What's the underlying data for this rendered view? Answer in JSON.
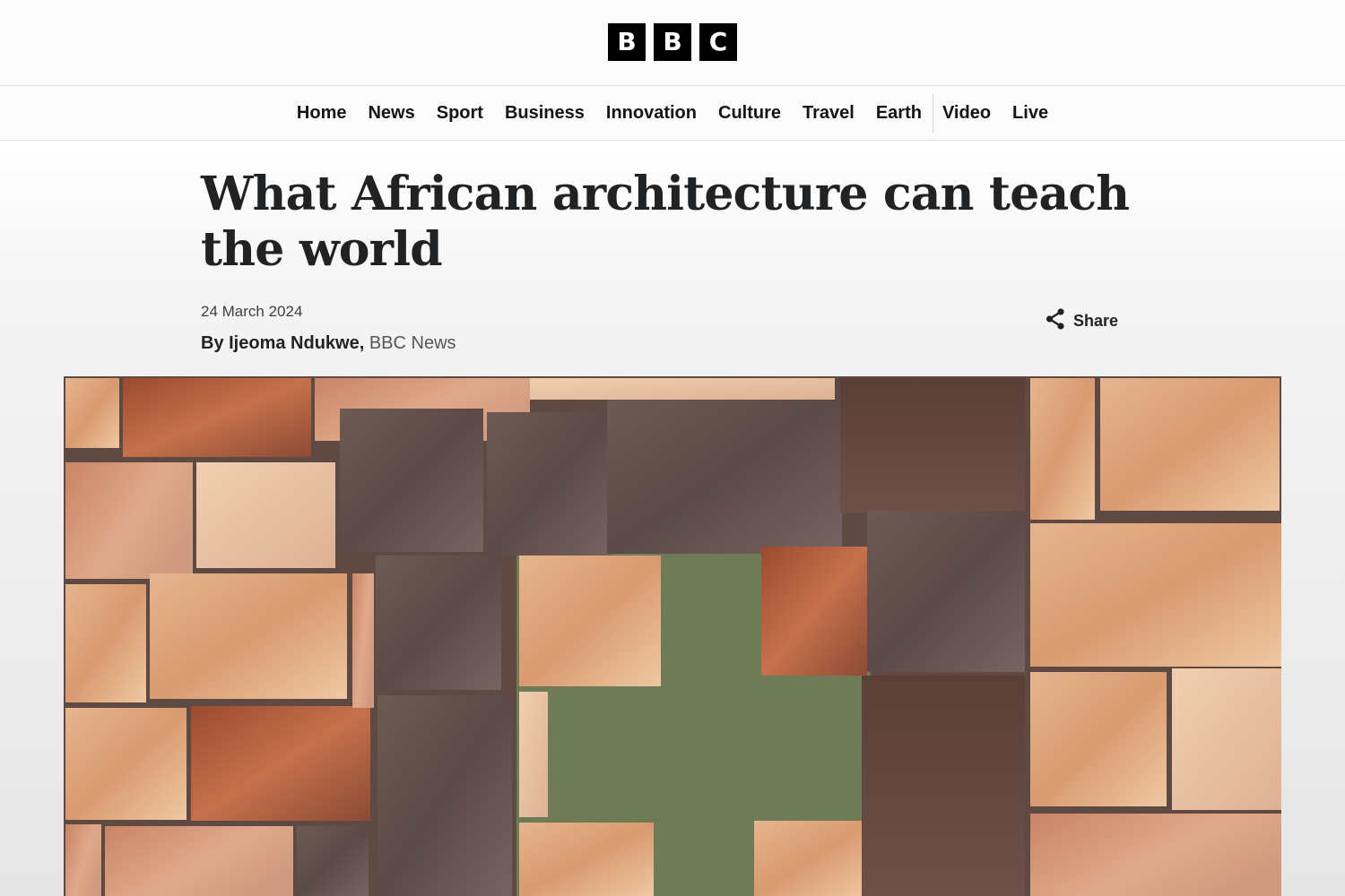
{
  "brand": {
    "logo_letters": [
      "B",
      "B",
      "C"
    ],
    "logo_color": "#000000"
  },
  "nav": {
    "items": [
      "Home",
      "News",
      "Sport",
      "Business",
      "Innovation",
      "Culture",
      "Travel",
      "Earth",
      "Video",
      "Live"
    ]
  },
  "article": {
    "headline": "What African architecture can teach the world",
    "date": "24 March 2024",
    "byline": {
      "author": "By Ijeoma Ndukwe,",
      "org": "BBC News"
    },
    "share_label": "Share",
    "share_icon": "share-icon",
    "hero_image": "salt-brick-wall-with-cross-window"
  }
}
